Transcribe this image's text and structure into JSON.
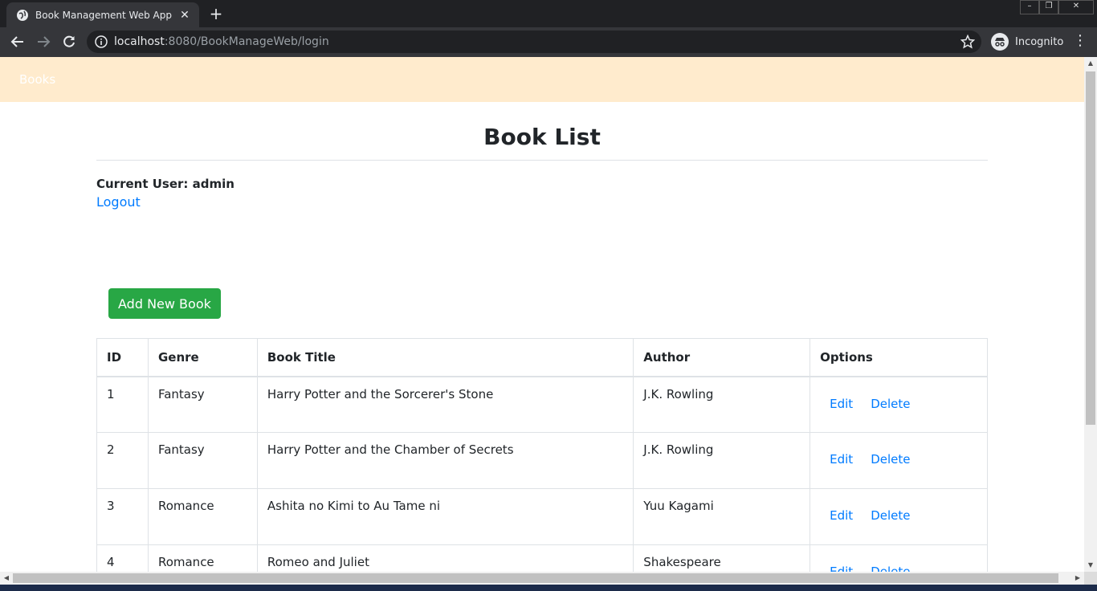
{
  "browser": {
    "tab_title": "Book Management Web App",
    "new_tab_symbol": "+",
    "url_host": "localhost",
    "url_rest": ":8080/BookManageWeb/login",
    "incognito_label": "Incognito"
  },
  "navbar": {
    "brand": "Books"
  },
  "page": {
    "title": "Book List",
    "current_user": "Current User: admin",
    "logout": "Logout",
    "add_button": "Add New Book"
  },
  "table": {
    "headers": {
      "id": "ID",
      "genre": "Genre",
      "title": "Book Title",
      "author": "Author",
      "options": "Options"
    },
    "edit_label": "Edit",
    "delete_label": "Delete",
    "rows": [
      {
        "id": "1",
        "genre": "Fantasy",
        "title": "Harry Potter and the Sorcerer's Stone",
        "author": "J.K. Rowling"
      },
      {
        "id": "2",
        "genre": "Fantasy",
        "title": "Harry Potter and the Chamber of Secrets",
        "author": "J.K. Rowling"
      },
      {
        "id": "3",
        "genre": "Romance",
        "title": "Ashita no Kimi to Au Tame ni",
        "author": "Yuu Kagami"
      },
      {
        "id": "4",
        "genre": "Romance",
        "title": "Romeo and Juliet",
        "author": "Shakespeare"
      }
    ]
  },
  "colors": {
    "navbar_bg": "#ffebcd",
    "link": "#007bff",
    "add_button_bg": "#28a745"
  }
}
